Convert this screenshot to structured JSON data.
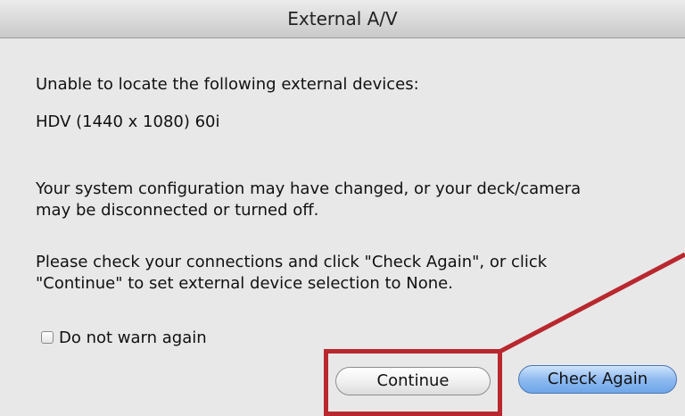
{
  "window": {
    "title": "External A/V"
  },
  "message": {
    "line1": "Unable to locate the following external devices:",
    "device": "HDV (1440 x 1080) 60i",
    "para2_line1": "Your system configuration may have changed, or your deck/camera",
    "para2_line2": "may be disconnected or turned off.",
    "para3_line1": "Please check your connections and click \"Check Again\", or click",
    "para3_line2": "\"Continue\" to set external device selection to None."
  },
  "options": {
    "do_not_warn_label": "Do not warn again",
    "do_not_warn_checked": false
  },
  "buttons": {
    "continue_label": "Continue",
    "check_again_label": "Check Again"
  },
  "annotation": {
    "color": "#b8282e"
  },
  "colors": {
    "default_button": "#8fbaf0",
    "dialog_background": "#e8e8e8"
  }
}
